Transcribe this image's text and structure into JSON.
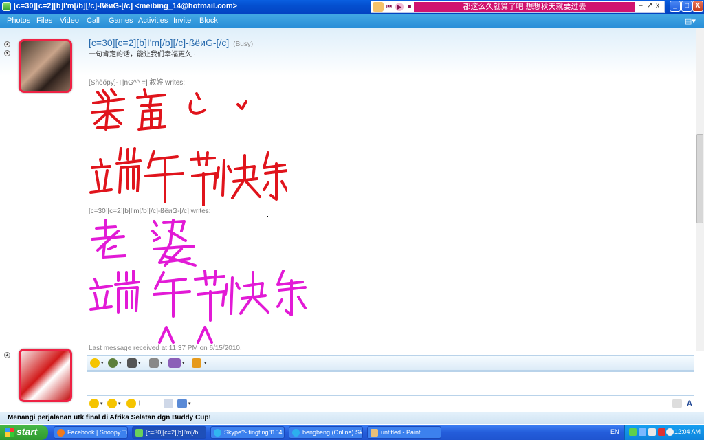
{
  "window": {
    "title": "[c=30][c=2][b]I'm[/b][/c]-ßёиG-[/c] <meibing_14@hotmail.com>",
    "now_playing": "都这么久就算了吧 想想秋天就要过去",
    "minimize": "_",
    "maximize": "□",
    "close": "X",
    "np_min": "–",
    "np_restore": "↗",
    "np_close": "x"
  },
  "menu": {
    "items": [
      "Photos",
      "Files",
      "Video",
      "Call",
      "Games",
      "Activities",
      "Invite",
      "Block"
    ]
  },
  "contact": {
    "name": "[c=30][c=2][b]I'm[/b][/c]-ßёиG-[/c]",
    "status": "(Busy)",
    "personal_message": "一句肯定的话，能让我们幸福更久~"
  },
  "conversation": {
    "msg1_sender": "[Sñõõpy]-T|nG^^ =] 叙婷 writes:",
    "msg2_sender": "[c=30][c=2][b]I'm[/b][/c]-ßёиG-[/c] writes:",
    "last_received": "Last message received at 11:37 PM on 6/15/2010."
  },
  "statusline": {
    "ad": "Menangi perjalanan utk final di Afrika Selatan dgn Buddy Cup!"
  },
  "taskbar": {
    "start": "start",
    "tasks": [
      "Facebook | Snoopy Ti...",
      "[c=30][c=2][b]I'm[/b...",
      "Skype?- tingting8154",
      "bengbeng (Online) Sk...",
      "untitled - Paint"
    ],
    "language": "EN",
    "clock": "12:04 AM"
  },
  "colors": {
    "ink_red": "#e0141c",
    "ink_magenta": "#e21ad6",
    "title_blue": "#0450d0",
    "menu_blue": "#2a8fd8",
    "contact_blue": "#2a6cae"
  }
}
